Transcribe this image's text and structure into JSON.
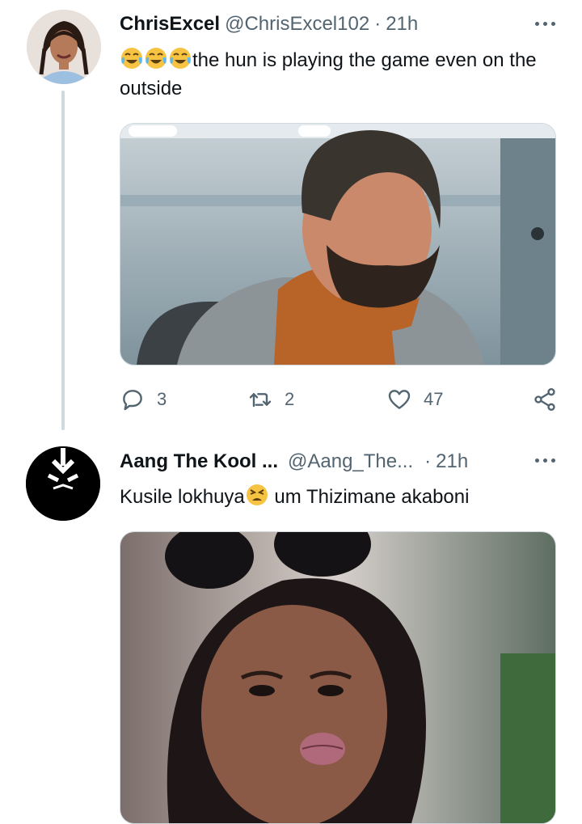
{
  "tweets": [
    {
      "author_name": "ChrisExcel",
      "author_handle": "@ChrisExcel102",
      "separator": "·",
      "time": "21h",
      "emoji_icons": [
        "face-with-tears-of-joy-icon",
        "face-with-tears-of-joy-icon",
        "face-with-tears-of-joy-icon"
      ],
      "text": "the hun is playing the game even on the outside",
      "media_description_icon": "video-still-man-turtleneck",
      "actions": {
        "reply_count": "3",
        "retweet_count": "2",
        "like_count": "47"
      }
    },
    {
      "author_name": "Aang The Kool ...",
      "author_handle": "@Aang_The...",
      "separator": "·",
      "time": "21h",
      "text_before_emoji": "Kusile lokhuya",
      "emoji_icon": "tired-face-icon",
      "text_after_emoji": " um Thizimane akaboni",
      "media_description_icon": "video-still-woman-mouse-ears"
    }
  ],
  "colors": {
    "text": "#0f1419",
    "secondary": "#536471",
    "border": "#cfd9de"
  }
}
